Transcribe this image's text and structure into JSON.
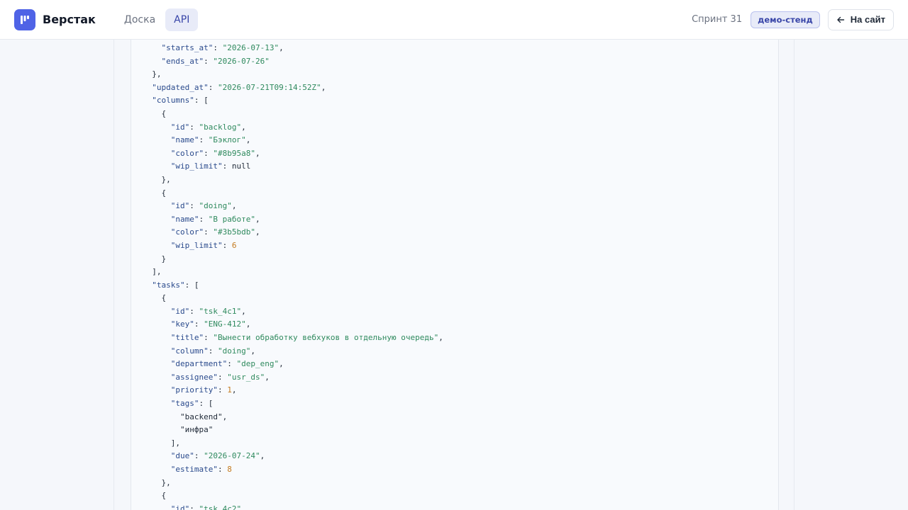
{
  "header": {
    "brand": "Верстак",
    "tabs": [
      {
        "label": "Доска",
        "active": false
      },
      {
        "label": "API",
        "active": true
      }
    ],
    "sprint": "Спринт 31",
    "env_badge": "демо-стенд",
    "back_label": "На сайт"
  },
  "colors": {
    "accent": "#4f63e6",
    "json_key": "#2a4a8c",
    "json_string": "#2f8a5e",
    "json_number": "#c47a1e"
  },
  "code_lines": [
    [
      [
        2,
        ""
      ],
      [
        "k",
        "\"starts_at\""
      ],
      [
        "p",
        ": "
      ],
      [
        "s",
        "\"2026-07-13\""
      ],
      [
        "p",
        ","
      ]
    ],
    [
      [
        2,
        ""
      ],
      [
        "k",
        "\"ends_at\""
      ],
      [
        "p",
        ": "
      ],
      [
        "s",
        "\"2026-07-26\""
      ]
    ],
    [
      [
        1,
        ""
      ],
      [
        "p",
        "},"
      ]
    ],
    [
      [
        1,
        ""
      ],
      [
        "k",
        "\"updated_at\""
      ],
      [
        "p",
        ": "
      ],
      [
        "s",
        "\"2026-07-21T09:14:52Z\""
      ],
      [
        "p",
        ","
      ]
    ],
    [
      [
        1,
        ""
      ],
      [
        "k",
        "\"columns\""
      ],
      [
        "p",
        ": ["
      ]
    ],
    [
      [
        2,
        ""
      ],
      [
        "p",
        "{"
      ]
    ],
    [
      [
        3,
        ""
      ],
      [
        "k",
        "\"id\""
      ],
      [
        "p",
        ": "
      ],
      [
        "s",
        "\"backlog\""
      ],
      [
        "p",
        ","
      ]
    ],
    [
      [
        3,
        ""
      ],
      [
        "k",
        "\"name\""
      ],
      [
        "p",
        ": "
      ],
      [
        "s",
        "\"Бэклог\""
      ],
      [
        "p",
        ","
      ]
    ],
    [
      [
        3,
        ""
      ],
      [
        "k",
        "\"color\""
      ],
      [
        "p",
        ": "
      ],
      [
        "s",
        "\"#8b95a8\""
      ],
      [
        "p",
        ","
      ]
    ],
    [
      [
        3,
        ""
      ],
      [
        "k",
        "\"wip_limit\""
      ],
      [
        "p",
        ": "
      ],
      [
        "l",
        "null"
      ]
    ],
    [
      [
        2,
        ""
      ],
      [
        "p",
        "},"
      ]
    ],
    [
      [
        2,
        ""
      ],
      [
        "p",
        "{"
      ]
    ],
    [
      [
        3,
        ""
      ],
      [
        "k",
        "\"id\""
      ],
      [
        "p",
        ": "
      ],
      [
        "s",
        "\"doing\""
      ],
      [
        "p",
        ","
      ]
    ],
    [
      [
        3,
        ""
      ],
      [
        "k",
        "\"name\""
      ],
      [
        "p",
        ": "
      ],
      [
        "s",
        "\"В работе\""
      ],
      [
        "p",
        ","
      ]
    ],
    [
      [
        3,
        ""
      ],
      [
        "k",
        "\"color\""
      ],
      [
        "p",
        ": "
      ],
      [
        "s",
        "\"#3b5bdb\""
      ],
      [
        "p",
        ","
      ]
    ],
    [
      [
        3,
        ""
      ],
      [
        "k",
        "\"wip_limit\""
      ],
      [
        "p",
        ": "
      ],
      [
        "n",
        "6"
      ]
    ],
    [
      [
        2,
        ""
      ],
      [
        "p",
        "}"
      ]
    ],
    [
      [
        1,
        ""
      ],
      [
        "p",
        "],"
      ]
    ],
    [
      [
        1,
        ""
      ],
      [
        "k",
        "\"tasks\""
      ],
      [
        "p",
        ": ["
      ]
    ],
    [
      [
        2,
        ""
      ],
      [
        "p",
        "{"
      ]
    ],
    [
      [
        3,
        ""
      ],
      [
        "k",
        "\"id\""
      ],
      [
        "p",
        ": "
      ],
      [
        "s",
        "\"tsk_4c1\""
      ],
      [
        "p",
        ","
      ]
    ],
    [
      [
        3,
        ""
      ],
      [
        "k",
        "\"key\""
      ],
      [
        "p",
        ": "
      ],
      [
        "s",
        "\"ENG-412\""
      ],
      [
        "p",
        ","
      ]
    ],
    [
      [
        3,
        ""
      ],
      [
        "k",
        "\"title\""
      ],
      [
        "p",
        ": "
      ],
      [
        "s",
        "\"Вынести обработку вебхуков в отдельную очередь\""
      ],
      [
        "p",
        ","
      ]
    ],
    [
      [
        3,
        ""
      ],
      [
        "k",
        "\"column\""
      ],
      [
        "p",
        ": "
      ],
      [
        "s",
        "\"doing\""
      ],
      [
        "p",
        ","
      ]
    ],
    [
      [
        3,
        ""
      ],
      [
        "k",
        "\"department\""
      ],
      [
        "p",
        ": "
      ],
      [
        "s",
        "\"dep_eng\""
      ],
      [
        "p",
        ","
      ]
    ],
    [
      [
        3,
        ""
      ],
      [
        "k",
        "\"assignee\""
      ],
      [
        "p",
        ": "
      ],
      [
        "s",
        "\"usr_ds\""
      ],
      [
        "p",
        ","
      ]
    ],
    [
      [
        3,
        ""
      ],
      [
        "k",
        "\"priority\""
      ],
      [
        "p",
        ": "
      ],
      [
        "n",
        "1"
      ],
      [
        "p",
        ","
      ]
    ],
    [
      [
        3,
        ""
      ],
      [
        "k",
        "\"tags\""
      ],
      [
        "p",
        ": ["
      ]
    ],
    [
      [
        4,
        ""
      ],
      [
        "l",
        "\"backend\""
      ],
      [
        "p",
        ","
      ]
    ],
    [
      [
        4,
        ""
      ],
      [
        "l",
        "\"инфра\""
      ]
    ],
    [
      [
        3,
        ""
      ],
      [
        "p",
        "],"
      ]
    ],
    [
      [
        3,
        ""
      ],
      [
        "k",
        "\"due\""
      ],
      [
        "p",
        ": "
      ],
      [
        "s",
        "\"2026-07-24\""
      ],
      [
        "p",
        ","
      ]
    ],
    [
      [
        3,
        ""
      ],
      [
        "k",
        "\"estimate\""
      ],
      [
        "p",
        ": "
      ],
      [
        "n",
        "8"
      ]
    ],
    [
      [
        2,
        ""
      ],
      [
        "p",
        "},"
      ]
    ],
    [
      [
        2,
        ""
      ],
      [
        "p",
        "{"
      ]
    ],
    [
      [
        3,
        ""
      ],
      [
        "k",
        "\"id\""
      ],
      [
        "p",
        ": "
      ],
      [
        "s",
        "\"tsk_4c2\""
      ],
      [
        "p",
        ","
      ]
    ]
  ]
}
